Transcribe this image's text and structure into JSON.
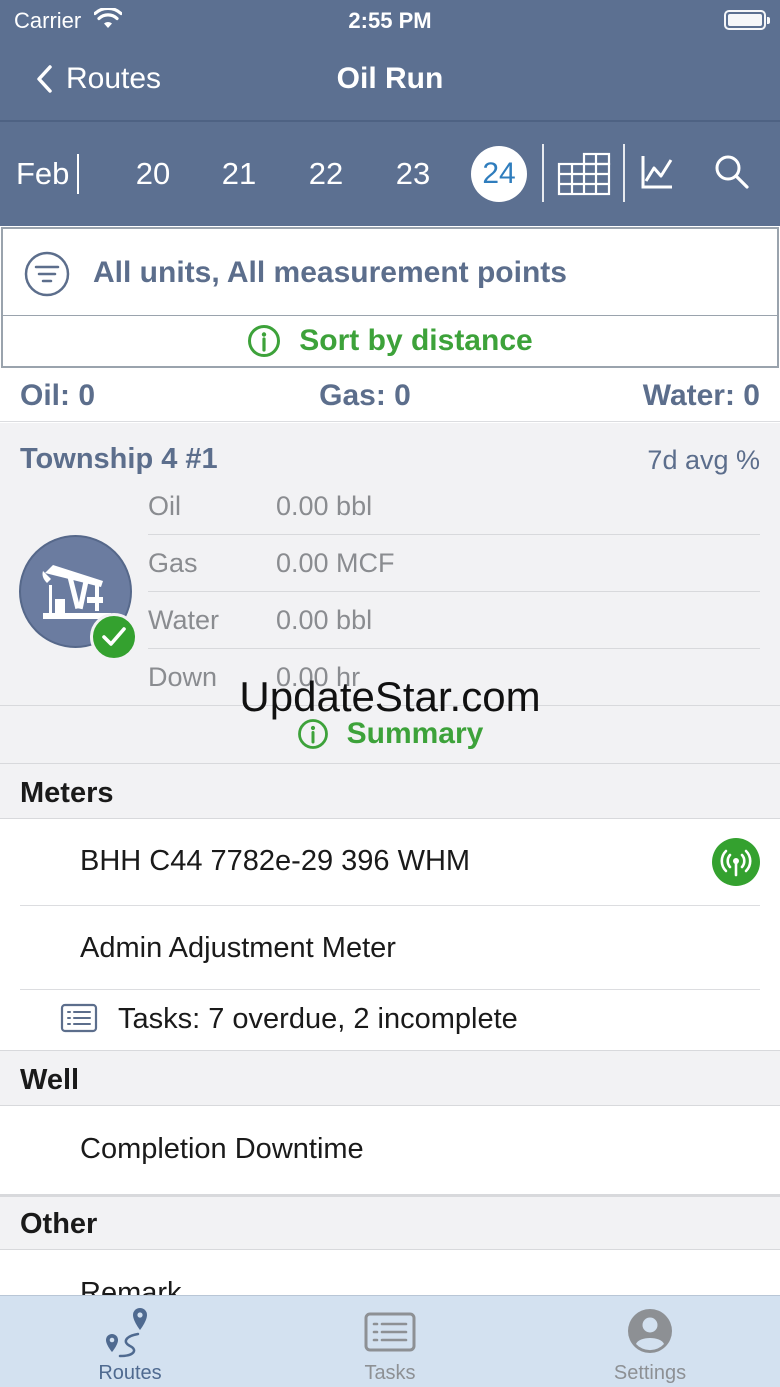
{
  "status_bar": {
    "carrier": "Carrier",
    "time": "2:55 PM"
  },
  "nav": {
    "back_label": "Routes",
    "title": "Oil Run"
  },
  "date_bar": {
    "month": "Feb",
    "days": [
      "20",
      "21",
      "22",
      "23"
    ],
    "selected_day": "24"
  },
  "filter": {
    "label": "All units, All measurement points"
  },
  "sort": {
    "label": "Sort by distance"
  },
  "totals": {
    "oil": "Oil: 0",
    "gas": "Gas: 0",
    "water": "Water: 0"
  },
  "unit": {
    "name": "Township 4 #1",
    "avg_label": "7d avg %",
    "metrics": [
      {
        "label": "Oil",
        "value": "0.00 bbl"
      },
      {
        "label": "Gas",
        "value": "0.00 MCF"
      },
      {
        "label": "Water",
        "value": "0.00 bbl"
      },
      {
        "label": "Down",
        "value": "0.00 hr"
      }
    ],
    "summary_label": "Summary"
  },
  "watermark": "UpdateStar.com",
  "sections": {
    "meters": {
      "header": "Meters",
      "items": [
        "BHH C44 7782e-29 396 WHM",
        "Admin Adjustment Meter"
      ],
      "tasks": "Tasks: 7 overdue, 2 incomplete"
    },
    "well": {
      "header": "Well",
      "items": [
        "Completion Downtime"
      ]
    },
    "other": {
      "header": "Other",
      "items": [
        "Remark"
      ]
    }
  },
  "tabbar": {
    "tabs": [
      {
        "label": "Routes",
        "icon": "route-icon",
        "active": true
      },
      {
        "label": "Tasks",
        "icon": "tasks-list-icon",
        "active": false
      },
      {
        "label": "Settings",
        "icon": "person-icon",
        "active": false
      }
    ]
  },
  "colors": {
    "header_bg": "#5c7091",
    "accent_green": "#3da23a",
    "label_slate": "#5c6e8c",
    "selected_day_text": "#2f7dbd",
    "tab_active": "#4f6a90",
    "tab_inactive": "#8d9094"
  }
}
